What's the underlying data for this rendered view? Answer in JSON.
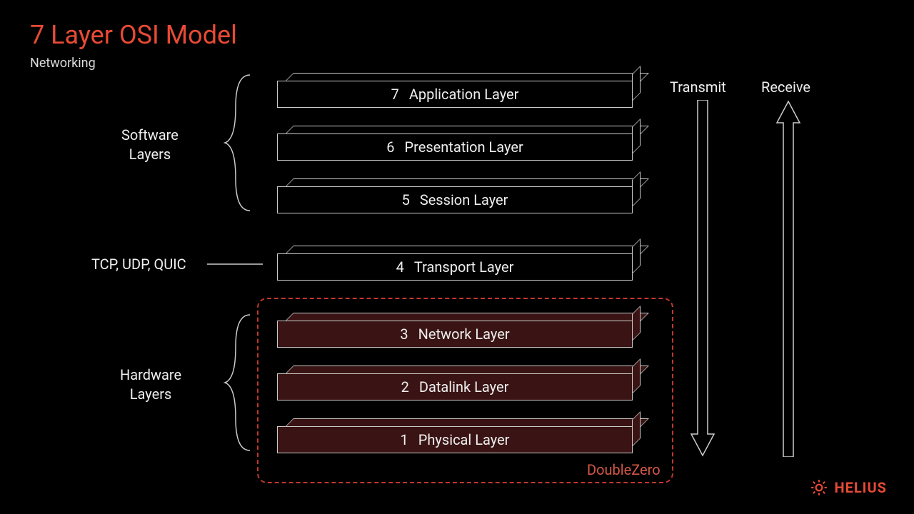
{
  "title": "7 Layer OSI Model",
  "subtitle": "Networking",
  "groups": {
    "software": "Software\nLayers",
    "hardware": "Hardware\nLayers"
  },
  "side_label": "TCP, UDP, QUIC",
  "layers": [
    {
      "num": "7",
      "name": "Application Layer"
    },
    {
      "num": "6",
      "name": "Presentation Layer"
    },
    {
      "num": "5",
      "name": "Session Layer"
    },
    {
      "num": "4",
      "name": "Transport Layer"
    },
    {
      "num": "3",
      "name": "Network Layer"
    },
    {
      "num": "2",
      "name": "Datalink Layer"
    },
    {
      "num": "1",
      "name": "Physical Layer"
    }
  ],
  "dz_label": "DoubleZero",
  "arrows": {
    "transmit": "Transmit",
    "receive": "Receive"
  },
  "brand": "HELIUS"
}
